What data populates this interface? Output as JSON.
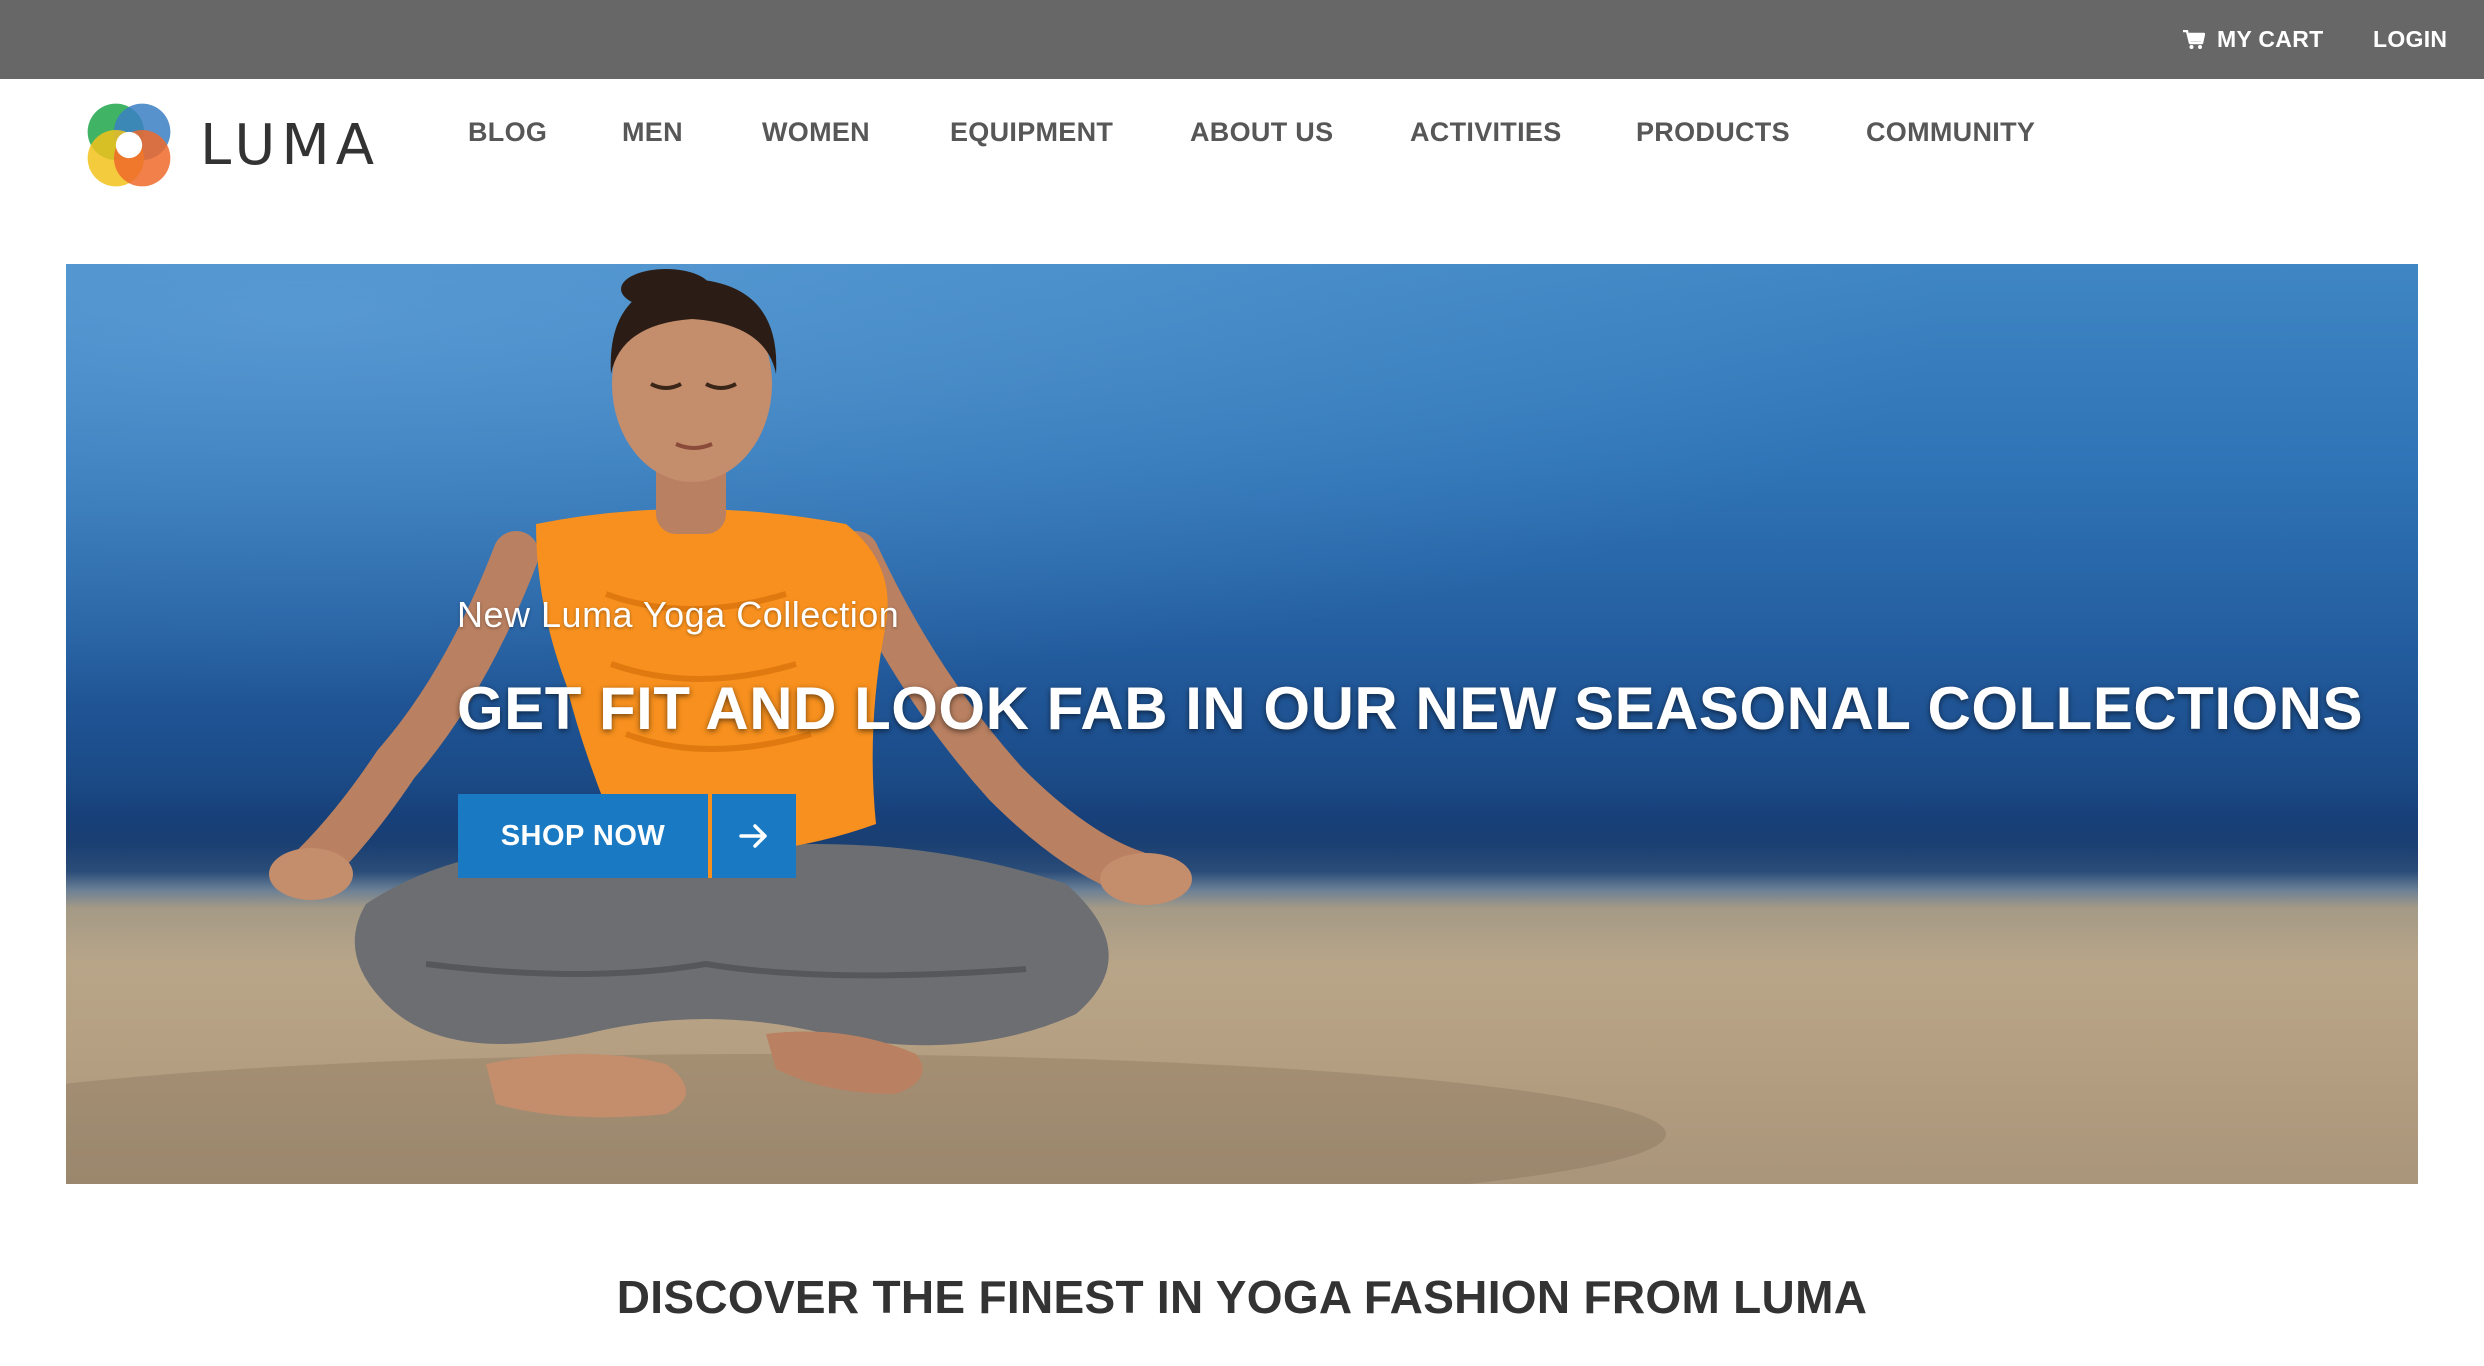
{
  "topbar": {
    "cart_label": "MY CART",
    "login_label": "LOGIN",
    "cart_icon": "cart-icon"
  },
  "header": {
    "logo_text": "LUMA",
    "nav": [
      {
        "label": "BLOG"
      },
      {
        "label": "MEN"
      },
      {
        "label": "WOMEN"
      },
      {
        "label": "EQUIPMENT"
      },
      {
        "label": "ABOUT US"
      },
      {
        "label": "ACTIVITIES"
      },
      {
        "label": "PRODUCTS"
      },
      {
        "label": "COMMUNITY"
      }
    ]
  },
  "hero": {
    "subtitle": "New Luma Yoga Collection",
    "title": "GET FIT AND LOOK FAB IN OUR NEW SEASONAL COLLECTIONS",
    "button_label": "SHOP NOW",
    "button_icon": "arrow-right-icon"
  },
  "main": {
    "discover_heading": "DISCOVER THE FINEST IN YOGA FASHION FROM LUMA"
  },
  "colors": {
    "topbar_bg": "#676767",
    "button_blue": "#1979c3",
    "button_separator": "#f7901e",
    "nav_text": "#575757"
  }
}
